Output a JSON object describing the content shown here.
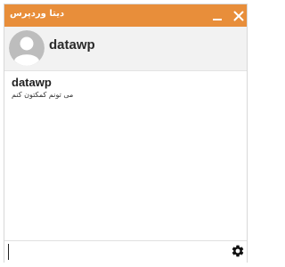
{
  "window": {
    "title": "دیتا وردپرس"
  },
  "titlebar": {
    "minimize_icon": "minimize-icon",
    "close_icon": "close-icon"
  },
  "profile": {
    "name": "datawp",
    "avatar_icon": "user-avatar-icon"
  },
  "messages": [
    {
      "author": "datawp",
      "text": "می تونم کمکتون کنم"
    }
  ],
  "composer": {
    "value": "",
    "settings_icon": "gear-icon"
  },
  "colors": {
    "titlebar": "#e88e3a",
    "profile_bg": "#f2f2f2",
    "avatar_bg": "#bdbdbd"
  }
}
